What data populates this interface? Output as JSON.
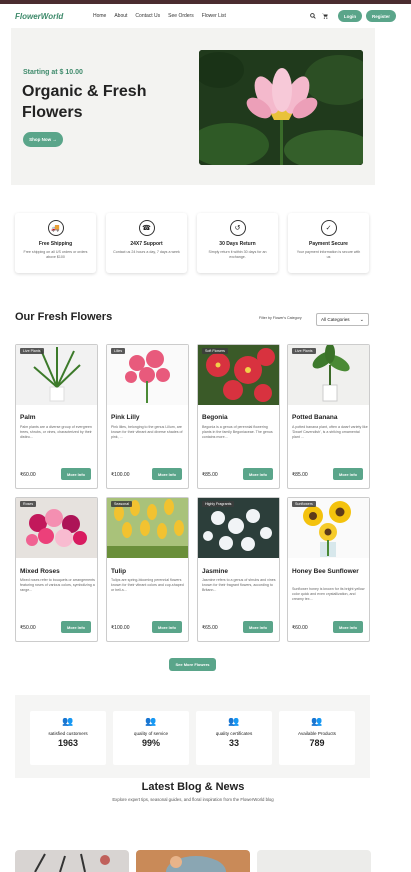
{
  "nav": {
    "logo": "FlowerWorld",
    "links": [
      "Home",
      "About",
      "Contact Us",
      "See Orders",
      "Flower List"
    ],
    "login": "Login",
    "register": "Register"
  },
  "hero": {
    "tagline": "Starting at $ 10.00",
    "title": "Organic & Fresh Flowers",
    "button": "Shop Now →"
  },
  "features": [
    {
      "icon": "truck-icon",
      "title": "Free Shipping",
      "desc": "Free shipping on all US orders or orders above $100"
    },
    {
      "icon": "support-icon",
      "title": "24X7 Support",
      "desc": "Contact us 24 hours a day, 7 days a week"
    },
    {
      "icon": "return-icon",
      "title": "30 Days Return",
      "desc": "Simply return it within 30 days for an exchange."
    },
    {
      "icon": "shield-icon",
      "title": "Payment Secure",
      "desc": "Your payment information is secure with us"
    }
  ],
  "section": {
    "title": "Our Fresh Flowers",
    "filter_label": "Filter by Flower's Category",
    "filter_value": "All Categories"
  },
  "products": [
    {
      "badge": "Live Plants",
      "name": "Palm",
      "desc": "Palm plants are a diverse group of evergreen trees, shrubs, or vines, characterized by their distinc...",
      "price": "₹60.00",
      "button": "More Info"
    },
    {
      "badge": "Lilies",
      "name": "Pink Lilly",
      "desc": "Pink lilies, belonging to the genus Lilium, are known for their vibrant and diverse shades of pink, ...",
      "price": "₹100.00",
      "button": "More Info"
    },
    {
      "badge": "Soft Flowers",
      "name": "Begonia",
      "desc": "Begonia is a genus of perennial flowering plants in the family Begoniaceae. The genus contains more...",
      "price": "₹85.00",
      "button": "More Info"
    },
    {
      "badge": "Live Plants",
      "name": "Potted Banana",
      "desc": "A potted banana plant, often a dwarf variety like 'Dwarf Cavendish', is a striking ornamental plant ...",
      "price": "₹85.00",
      "button": "More Info"
    },
    {
      "badge": "Roses",
      "name": "Mixed Roses",
      "desc": "Mixed roses refer to bouquets or arrangements featuring roses of various colors, symbolizing a range...",
      "price": "₹50.00",
      "button": "More Info"
    },
    {
      "badge": "Seasonal",
      "name": "Tulip",
      "desc": "Tulips are spring-blooming perennial flowers known for their vibrant colors and cup-shaped or bell-s...",
      "price": "₹100.00",
      "button": "More Info"
    },
    {
      "badge": "Highly Fragrants",
      "name": "Jasmine",
      "desc": "Jasmine refers to a genus of shrubs and vines known for their fragrant flowers, according to Britann...",
      "price": "₹65.00",
      "button": "More Info"
    },
    {
      "badge": "Sunflowers",
      "name": "Honey Bee Sunflower",
      "desc": "Sunflower honey is known for its bright yellow color quick and even crystallization, and creamy tex...",
      "price": "₹60.00",
      "button": "More Info"
    }
  ],
  "see_more": "See More Flowers",
  "stats": [
    {
      "label": "satisfied customers",
      "value": "1963"
    },
    {
      "label": "quality of service",
      "value": "99%"
    },
    {
      "label": "quality certificates",
      "value": "33"
    },
    {
      "label": "Available Products",
      "value": "789"
    }
  ],
  "blog": {
    "title": "Latest Blog & News",
    "subtitle": "Explore expert tips, seasonal guides, and floral inspiration from the FlowerWorld blog"
  },
  "colors": {
    "accent": "#5aa58a",
    "brand": "#3e8a6b",
    "topbar": "#4a2c2f"
  }
}
